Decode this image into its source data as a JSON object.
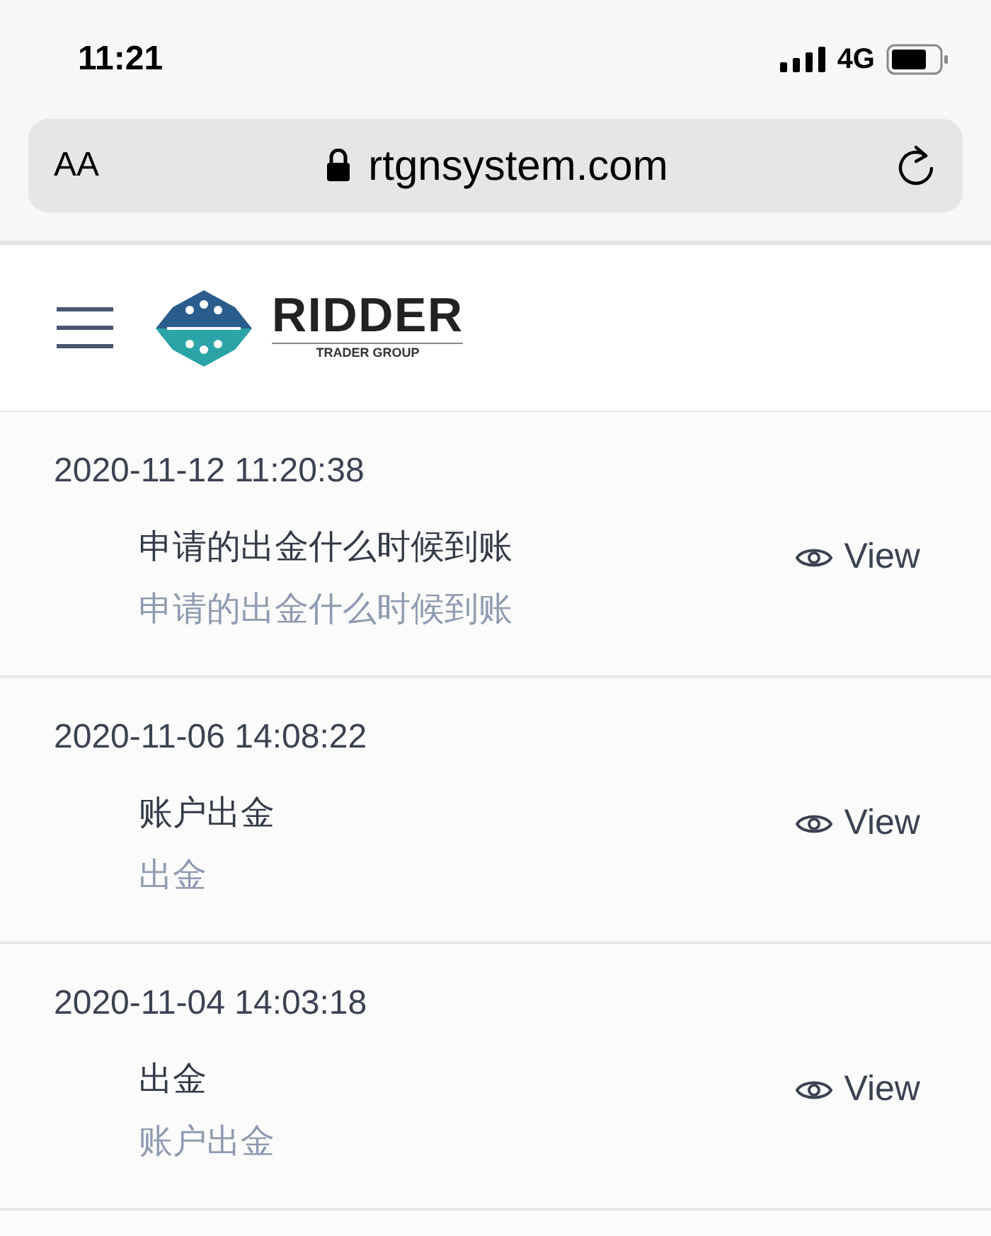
{
  "status_bar": {
    "time": "11:21",
    "network": "4G"
  },
  "browser": {
    "text_size_button": "AA",
    "url": "rtgnsystem.com"
  },
  "header": {
    "logo_name": "RIDDER",
    "logo_tagline": "TRADER GROUP"
  },
  "tickets": [
    {
      "date": "2020-11-12 11:20:38",
      "title": "申请的出金什么时候到账",
      "content": "申请的出金什么时候到账",
      "action": "View"
    },
    {
      "date": "2020-11-06 14:08:22",
      "title": "账户出金",
      "content": "出金",
      "action": "View"
    },
    {
      "date": "2020-11-04 14:03:18",
      "title": "出金",
      "content": "账户出金",
      "action": "View"
    }
  ]
}
